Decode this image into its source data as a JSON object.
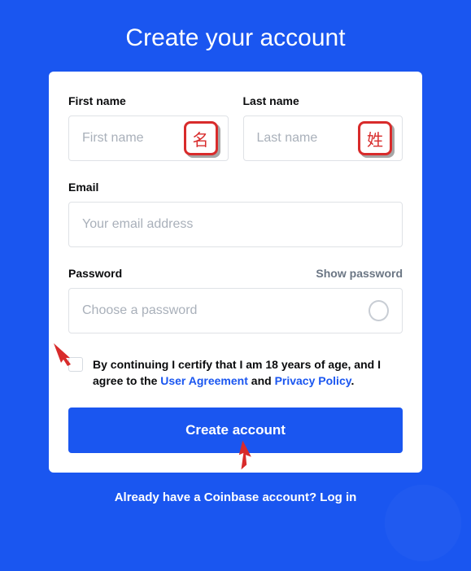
{
  "title": "Create your account",
  "firstName": {
    "label": "First name",
    "placeholder": "First name",
    "badge": "名"
  },
  "lastName": {
    "label": "Last name",
    "placeholder": "Last name",
    "badge": "姓"
  },
  "email": {
    "label": "Email",
    "placeholder": "Your email address"
  },
  "password": {
    "label": "Password",
    "placeholder": "Choose a password",
    "toggle": "Show password"
  },
  "consent": {
    "pre": "By continuing I certify that I am 18 years of age, and I agree to the ",
    "link1": "User Agreement",
    "mid": " and ",
    "link2": "Privacy Policy",
    "post": "."
  },
  "submit": "Create account",
  "footer": {
    "text": "Already have a Coinbase account? ",
    "link": "Log in"
  }
}
